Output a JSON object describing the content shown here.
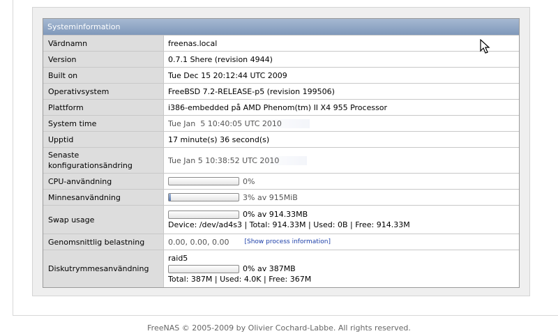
{
  "table": {
    "title": "Systeminformation",
    "hostname": {
      "label": "Värdnamn",
      "value": "freenas.local"
    },
    "version": {
      "label": "Version",
      "value": "0.7.1 Shere (revision 4944)"
    },
    "built": {
      "label": "Built on",
      "value": "Tue Dec 15 20:12:44 UTC 2009"
    },
    "os": {
      "label": "Operativsystem",
      "value": "FreeBSD 7.2-RELEASE-p5 (revision 199506)"
    },
    "platform": {
      "label": "Plattform",
      "value": "i386-embedded på AMD Phenom(tm) II X4 955 Processor"
    },
    "systime": {
      "label": "System time",
      "value": "Tue Jan  5 10:40:05 UTC 2010"
    },
    "uptime": {
      "label": "Upptid",
      "value": "17 minute(s) 36 second(s)"
    },
    "lastconfig": {
      "label": "Senaste konfigurationsändring",
      "value": "Tue Jan 5 10:38:52 UTC 2010"
    },
    "cpu": {
      "label": "CPU-användning",
      "percent": 0,
      "text": "0%"
    },
    "memory": {
      "label": "Minnesanvändning",
      "percent": 3,
      "text": "3% av 915MiB"
    },
    "swap": {
      "label": "Swap usage",
      "percent": 0,
      "text": "0% av 914.33MB",
      "detail": "Device: /dev/ad4s3 | Total: 914.33M | Used: 0B | Free: 914.33M"
    },
    "load": {
      "label": "Genomsnittlig belastning",
      "value": "0.00, 0.00, 0.00",
      "link": "[Show process information]"
    },
    "disk": {
      "label": "Diskutrymmesanvändning",
      "name": "raid5",
      "percent": 0,
      "text": "0% av 387MB",
      "detail": "Total: 387M | Used: 4.0K | Free: 367M"
    }
  },
  "footer": "FreeNAS © 2005-2009 by Olivier Cochard-Labbe. All rights reserved.",
  "colors": {
    "header": "#8ba2c2",
    "label_bg": "#dddddd",
    "bar_fill": "#6a87b8"
  },
  "icons": {
    "cursor": "arrow-cursor-icon"
  }
}
